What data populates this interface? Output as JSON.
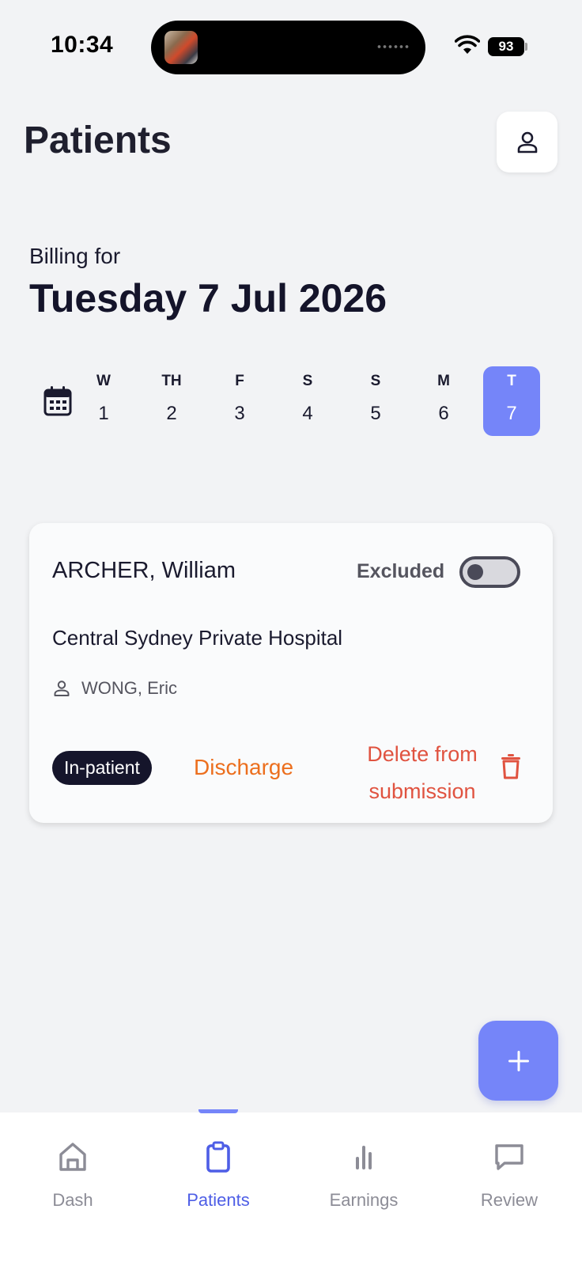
{
  "status_bar": {
    "time": "10:34",
    "battery": "93"
  },
  "header": {
    "title": "Patients"
  },
  "billing": {
    "label": "Billing for",
    "date": "Tuesday 7 Jul 2026"
  },
  "week": [
    {
      "dow": "W",
      "num": "1",
      "selected": false
    },
    {
      "dow": "TH",
      "num": "2",
      "selected": false
    },
    {
      "dow": "F",
      "num": "3",
      "selected": false
    },
    {
      "dow": "S",
      "num": "4",
      "selected": false
    },
    {
      "dow": "S",
      "num": "5",
      "selected": false
    },
    {
      "dow": "M",
      "num": "6",
      "selected": false
    },
    {
      "dow": "T",
      "num": "7",
      "selected": true
    }
  ],
  "patient_card": {
    "name": "ARCHER, William",
    "excluded_label": "Excluded",
    "excluded": false,
    "hospital": "Central Sydney Private Hospital",
    "doctor": "WONG, Eric",
    "status": "In-patient",
    "discharge_label": "Discharge",
    "delete_line1": "Delete from",
    "delete_line2": "submission"
  },
  "nav": [
    {
      "label": "Dash",
      "icon": "home-icon",
      "active": false
    },
    {
      "label": "Patients",
      "icon": "clipboard-icon",
      "active": true
    },
    {
      "label": "Earnings",
      "icon": "bar-chart-icon",
      "active": false
    },
    {
      "label": "Review",
      "icon": "message-icon",
      "active": false
    }
  ],
  "colors": {
    "accent": "#7585f9",
    "nav_active": "#4e5ee6",
    "discharge": "#ec6f1e",
    "delete": "#e05340",
    "badge": "#15152b"
  }
}
